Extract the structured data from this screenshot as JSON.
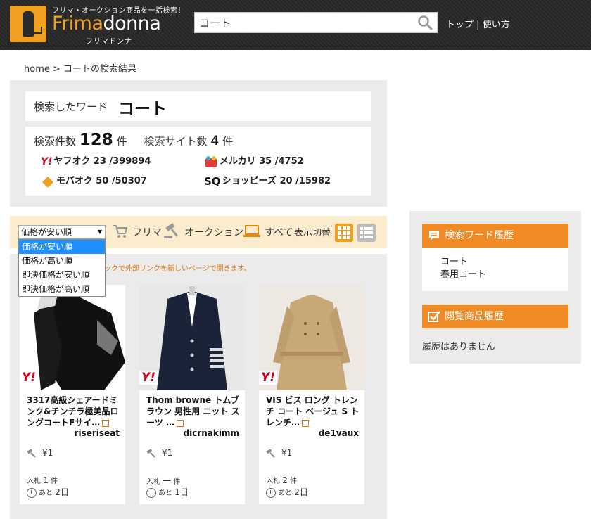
{
  "header": {
    "tagline": "フリマ・オークション商品を一括検索！",
    "logo_main": "Frima",
    "logo_accent": "donna",
    "logo_sub": "フリマドンナ",
    "search_value": "コート",
    "nav_top": "トップ",
    "nav_sep": "|",
    "nav_howto": "使い方"
  },
  "breadcrumb": "home > コートの検索結果",
  "summary": {
    "word_label": "検索したワード",
    "word_value": "コート",
    "count_label": "検索件数",
    "count_value": "128",
    "count_unit": "件",
    "site_label": "検索サイト数",
    "site_value": "4",
    "site_unit": "件",
    "sites": [
      {
        "name": "ヤフオク 23 /399894",
        "icon": "yahoo-icon"
      },
      {
        "name": "メルカリ 35 /4752",
        "icon": "mercari-icon"
      },
      {
        "name": "モバオク 50 /50307",
        "icon": "mobaoku-icon"
      },
      {
        "name": "ショッピーズ 20 /15982",
        "icon": "shoppies-icon"
      }
    ]
  },
  "toolbar": {
    "sort_selected": "価格が安い順",
    "sort_options": [
      "価格が安い順",
      "価格が高い順",
      "即決価格が安い順",
      "即決価格が高い順"
    ],
    "filter_frima": "フリマ",
    "filter_auction": "オークション",
    "filter_all": "すべて",
    "view_toggle_label": "表示切替"
  },
  "notice": "ックで外部リンクを新しいページで開きます。",
  "cards": [
    {
      "badge": "Y!",
      "title": "3317高級シェアードミンク&チンチラ極美品ロングコートFサイ…",
      "seller": "riseriseat",
      "price": "¥1",
      "bids_label": "入札",
      "bids_value": "1",
      "bids_unit": "件",
      "time_label": "あと",
      "time_value": "2日"
    },
    {
      "badge": "Y!",
      "title": "Thom browne トムブラウン 男性用 ニット スーツ …",
      "seller": "dicrnakimm",
      "price": "¥1",
      "bids_label": "入札",
      "bids_value": "一",
      "bids_unit": "件",
      "time_label": "あと",
      "time_value": "1日"
    },
    {
      "badge": "Y!",
      "title": "VIS ビス ロング トレンチ コート ベージュ S トレンチ…",
      "seller": "de1vaux",
      "price": "¥1",
      "bids_label": "入札",
      "bids_value": "2",
      "bids_unit": "件",
      "time_label": "あと",
      "time_value": "2日"
    }
  ],
  "sidebar": {
    "history_title": "検索ワード履歴",
    "history_items": [
      "コート",
      "春用コート"
    ],
    "viewed_title": "閲覧商品履歴",
    "viewed_empty": "履歴はありません"
  },
  "colors": {
    "accent": "#f0a020",
    "sidebar_head": "#ef8a25",
    "yahoo_red": "#d0021b",
    "header_bg": "#2b2b2b"
  }
}
